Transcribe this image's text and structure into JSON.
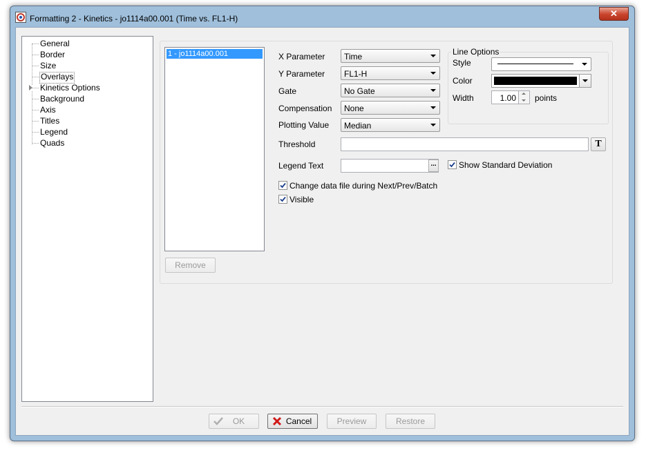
{
  "window": {
    "title": "Formatting 2 - Kinetics - jo1114a00.001 (Time vs. FL1-H)",
    "close_label": "✕"
  },
  "tree": {
    "items": [
      {
        "label": "General",
        "selected": false,
        "expandable": false
      },
      {
        "label": "Border",
        "selected": false,
        "expandable": false
      },
      {
        "label": "Size",
        "selected": false,
        "expandable": false
      },
      {
        "label": "Overlays",
        "selected": true,
        "expandable": false
      },
      {
        "label": "Kinetics Options",
        "selected": false,
        "expandable": true
      },
      {
        "label": "Background",
        "selected": false,
        "expandable": false
      },
      {
        "label": "Axis",
        "selected": false,
        "expandable": false
      },
      {
        "label": "Titles",
        "selected": false,
        "expandable": false
      },
      {
        "label": "Legend",
        "selected": false,
        "expandable": false
      },
      {
        "label": "Quads",
        "selected": false,
        "expandable": false
      }
    ]
  },
  "overlays": {
    "items": [
      "1 - jo1114a00.001"
    ],
    "remove_label": "Remove"
  },
  "params": {
    "x_label": "X Parameter",
    "x_value": "Time",
    "y_label": "Y Parameter",
    "y_value": "FL1-H",
    "gate_label": "Gate",
    "gate_value": "No Gate",
    "comp_label": "Compensation",
    "comp_value": "None",
    "plot_label": "Plotting Value",
    "plot_value": "Median",
    "threshold_label": "Threshold",
    "threshold_value": "",
    "legend_label": "Legend Text",
    "legend_value": "",
    "ellipsis_label": "...",
    "threshold_button": "T"
  },
  "checks": {
    "show_std_label": "Show Standard Deviation",
    "show_std": true,
    "change_file_label": "Change data file during Next/Prev/Batch",
    "change_file": true,
    "visible_label": "Visible",
    "visible": true
  },
  "line_options": {
    "group_label": "Line Options",
    "style_label": "Style",
    "color_label": "Color",
    "color_value": "#000000",
    "width_label": "Width",
    "width_value": "1.00",
    "width_unit": "points"
  },
  "footer": {
    "ok_label": "OK",
    "cancel_label": "Cancel",
    "preview_label": "Preview",
    "restore_label": "Restore"
  }
}
